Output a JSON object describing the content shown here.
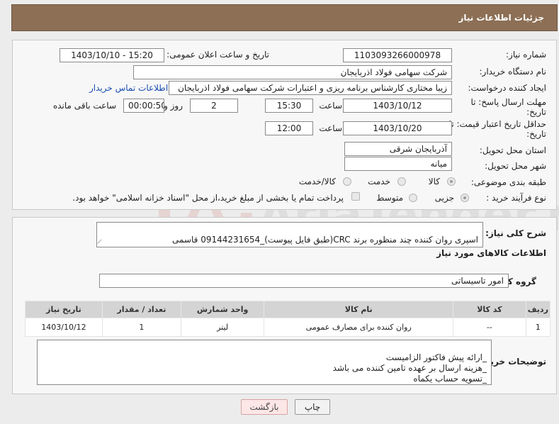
{
  "header": {
    "title": "جزئیات اطلاعات نیاز"
  },
  "form": {
    "need_number_label": "شماره نیاز:",
    "need_number": "1103093266000978",
    "announce_label": "تاریخ و ساعت اعلان عمومی:",
    "announce_value": "1403/10/10 - 15:20",
    "buyer_label": "نام دستگاه خریدار:",
    "buyer_value": "شرکت سهامی فولاد اذربایجان",
    "creator_label": "ایجاد کننده درخواست:",
    "creator_value": "زیبا مختاری کارشناس برنامه ریزی و اعتبارات شرکت سهامی فولاد اذربایجان",
    "contact_link": "اطلاعات تماس خریدار",
    "deadline_label_1": "مهلت ارسال پاسخ: تا",
    "deadline_label_2": "تاریخ:",
    "deadline_date": "1403/10/12",
    "time_label": "ساعت",
    "deadline_time": "15:30",
    "days_value": "2",
    "days_label": "روز و",
    "remaining_value": "00:00:50",
    "remaining_label": "ساعت باقی مانده",
    "validity_label_1": "حداقل تاریخ اعتبار قیمت: تا",
    "validity_label_2": "تاریخ:",
    "validity_date": "1403/10/20",
    "validity_time_label": "ساعت",
    "validity_time": "12:00",
    "province_label": "استان محل تحویل:",
    "province_value": "آذربایجان شرقی",
    "city_label": "شهر محل تحویل:",
    "city_value": "میانه",
    "category_label": "طبقه بندی موضوعی:",
    "category_options": [
      "کالا",
      "خدمت",
      "کالا/خدمت"
    ],
    "category_selected": "کالا",
    "process_label": "نوع فرآیند خرید :",
    "process_options": [
      "جزیی",
      "متوسط"
    ],
    "process_selected": "جزیی",
    "payment_note": "پرداخت تمام یا بخشی از مبلغ خرید،از محل \"اسناد خزانه اسلامی\" خواهد بود."
  },
  "details": {
    "description_label": "شرح کلی نیاز:",
    "description_value": "اسپری روان کننده چند منظوره برند CRC(طبق فایل پیوست)_09144231654 قاسمی",
    "goods_info_title": "اطلاعات کالاهای مورد نیاز",
    "group_label": "گروه کالا:",
    "group_value": "امور تاسیساتی",
    "table": {
      "headers": [
        "ردیف",
        "کد کالا",
        "نام کالا",
        "واحد شمارش",
        "تعداد / مقدار",
        "تاریخ نیاز"
      ],
      "rows": [
        [
          "1",
          "--",
          "روان کننده برای مصارف عمومی",
          "لیتر",
          "1",
          "1403/10/12"
        ]
      ]
    },
    "buyer_notes_label": "توضیحات خریدار:",
    "buyer_notes_value": "_ارائه پیش فاکتور الزامیست\n_هزینه ارسال بر عهده تامین کننده می باشد\n_تسویه حساب یکماه"
  },
  "buttons": {
    "print": "چاپ",
    "back": "بازگشت"
  },
  "watermark": "AriaTender.neT",
  "colors": {
    "header_bg": "#8c6f55",
    "link": "#1a4db3"
  }
}
